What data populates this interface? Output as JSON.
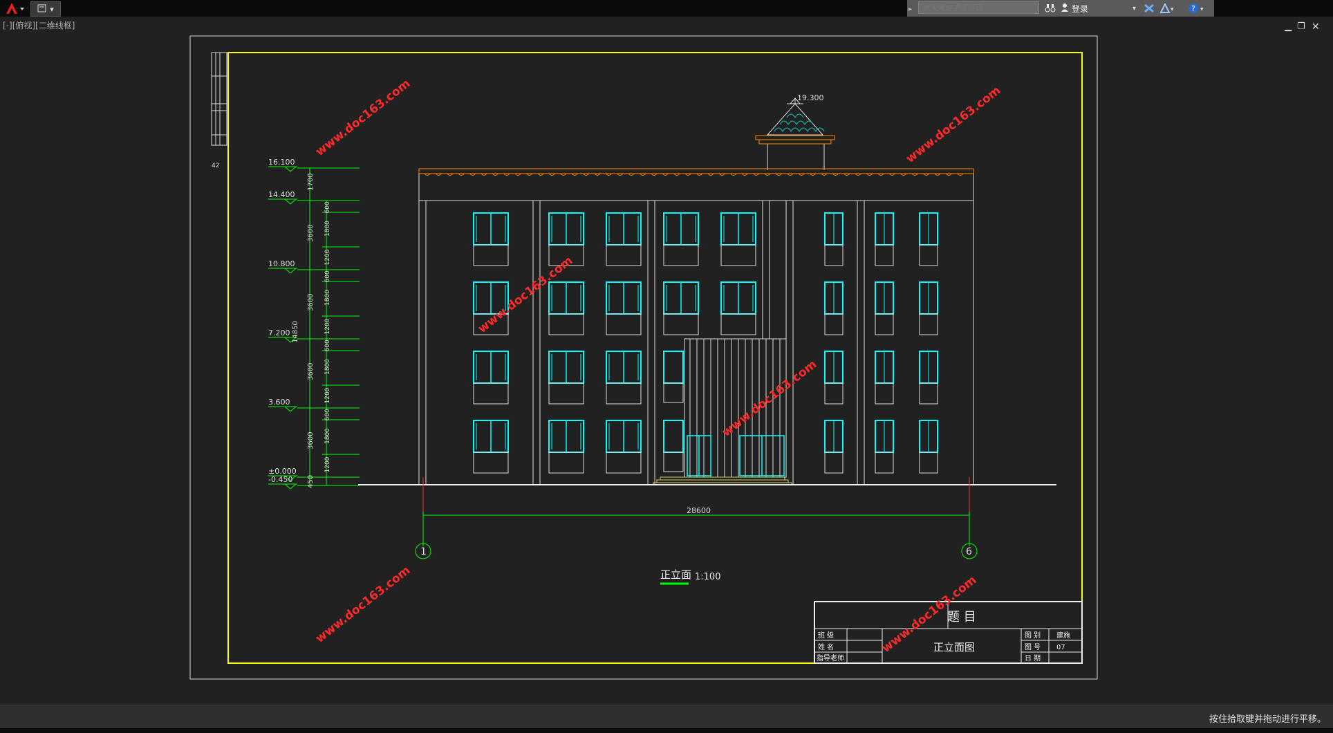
{
  "topbar": {
    "search_placeholder": "键入关键字或短语",
    "login_label": "登录"
  },
  "viewport_label": "[-][俯视][二维线框]",
  "drawing": {
    "elevations": [
      "16.100",
      "14.400",
      "10.800",
      "7.200",
      "3.600",
      "±0.000",
      "-0.450"
    ],
    "total_height": "14850",
    "dims_outer": [
      "1700",
      "3600",
      "3600",
      "3600",
      "3600",
      "450"
    ],
    "dims_inner": [
      "600",
      "1800",
      "1200",
      "600",
      "1800",
      "1200",
      "600",
      "1800",
      "1200",
      "600",
      "1800",
      "1200"
    ],
    "roof_top_elevation": "19.300",
    "overall_width": "28600",
    "axis_left": "1",
    "axis_right": "6",
    "view_title": "正立面",
    "scale": "1:100",
    "watermark": "www.doc163.com",
    "sidebar_mark": "42"
  },
  "title_block": {
    "header": "题  目",
    "drawing_name": "正立面图",
    "labels": [
      "班 级",
      "姓 名",
      "指导老师"
    ],
    "right_labels": [
      "图 别",
      "图 号",
      "日 期"
    ],
    "right_values": [
      "建施",
      "07",
      ""
    ]
  },
  "status": {
    "text": "按住拾取键并拖动进行平移。"
  },
  "colors": {
    "background": "#212121",
    "frame_yellow": "#ffff00",
    "dim_green": "#00ff00",
    "window_cyan": "#00ffff",
    "cornice_orange": "#ff8c00",
    "watermark_red": "#ff2a2a"
  }
}
